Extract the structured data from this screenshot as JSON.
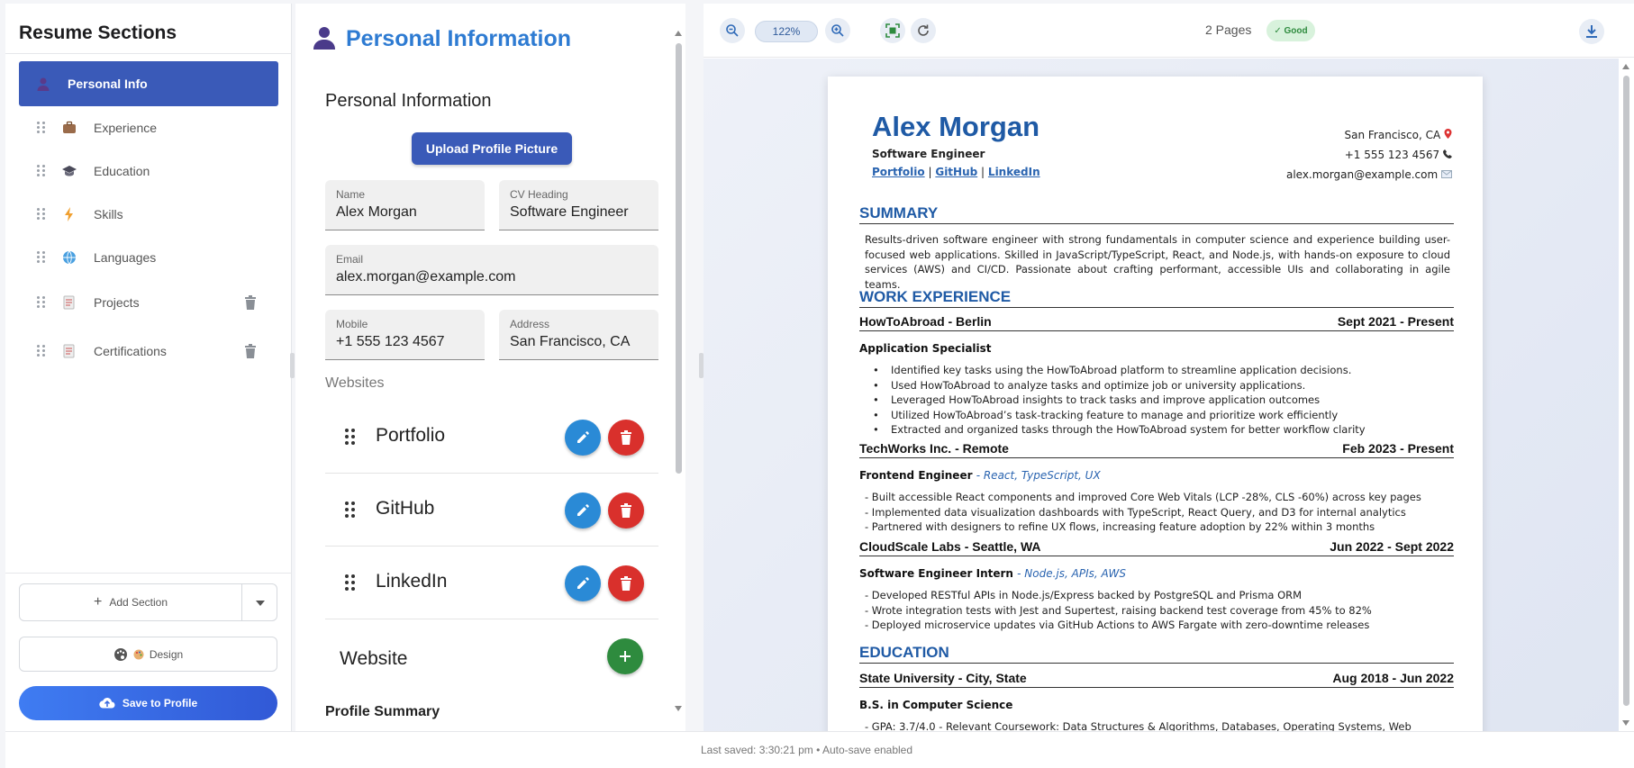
{
  "sidebar": {
    "title": "Resume Sections",
    "items": [
      {
        "label": "Personal Info",
        "icon": "person-icon",
        "active": true
      },
      {
        "label": "Experience",
        "icon": "briefcase-icon"
      },
      {
        "label": "Education",
        "icon": "graduation-cap-icon"
      },
      {
        "label": "Skills",
        "icon": "lightning-icon"
      },
      {
        "label": "Languages",
        "icon": "globe-icon"
      },
      {
        "label": "Projects",
        "icon": "document-icon",
        "deletable": true
      },
      {
        "label": "Certifications",
        "icon": "document-icon",
        "deletable": true
      }
    ],
    "add_section_label": "Add Section",
    "design_label": "Design",
    "save_label": "Save to Profile"
  },
  "editor": {
    "title": "Personal Information",
    "subtitle": "Personal Information",
    "upload_label": "Upload Profile Picture",
    "fields": {
      "name": {
        "label": "Name",
        "value": "Alex Morgan"
      },
      "cv_heading": {
        "label": "CV Heading",
        "value": "Software Engineer"
      },
      "email": {
        "label": "Email",
        "value": "alex.morgan@example.com"
      },
      "mobile": {
        "label": "Mobile",
        "value": "+1 555 123 4567"
      },
      "address": {
        "label": "Address",
        "value": "San Francisco, CA"
      }
    },
    "websites_label": "Websites",
    "websites": [
      "Portfolio",
      "GitHub",
      "LinkedIn"
    ],
    "website_add_label": "Website",
    "profile_summary_label": "Profile Summary"
  },
  "preview": {
    "zoom": "122%",
    "pages": "2 Pages",
    "quality_badge": "✓ Good",
    "resume": {
      "name": "Alex Morgan",
      "heading": "Software Engineer",
      "links": [
        "Portfolio",
        "GitHub",
        "LinkedIn"
      ],
      "link_separator": "|",
      "location": "San Francisco, CA",
      "phone": "+1 555 123 4567",
      "email": "alex.morgan@example.com",
      "summary_title": "SUMMARY",
      "summary_text": "Results-driven software engineer with strong fundamentals in computer science and experience building user-focused web applications. Skilled in JavaScript/TypeScript, React, and Node.js, with hands-on exposure to cloud services (AWS) and CI/CD. Passionate about crafting performant, accessible UIs and collaborating in agile teams.",
      "experience_title": "WORK EXPERIENCE",
      "jobs": [
        {
          "company": "HowToAbroad - Berlin",
          "dates": "Sept 2021 - Present",
          "role": "Application Specialist",
          "tags": "",
          "bullets": [
            "Identified key tasks using the HowToAbroad platform to streamline application decisions.",
            "Used HowToAbroad to analyze tasks and optimize job or university applications.",
            "Leveraged HowToAbroad insights to track tasks and improve application outcomes",
            "Utilized HowToAbroad’s task-tracking feature to manage and prioritize work efficiently",
            "Extracted and organized tasks through the HowToAbroad system for better workflow clarity"
          ]
        },
        {
          "company": "TechWorks Inc. - Remote",
          "dates": "Feb 2023 - Present",
          "role": "Frontend Engineer",
          "tags": "- React, TypeScript, UX",
          "bullets": [
            "- Built accessible React components and improved Core Web Vitals (LCP -28%, CLS -60%) across key pages",
            "- Implemented data visualization dashboards with TypeScript, React Query, and D3 for internal analytics",
            "- Partnered with designers to refine UX flows, increasing feature adoption by 22% within 3 months"
          ]
        },
        {
          "company": "CloudScale Labs - Seattle, WA",
          "dates": "Jun 2022 - Sept 2022",
          "role": "Software Engineer Intern",
          "tags": "- Node.js, APIs, AWS",
          "bullets": [
            "- Developed RESTful APIs in Node.js/Express backed by PostgreSQL and Prisma ORM",
            "- Wrote integration tests with Jest and Supertest, raising backend test coverage from 45% to 82%",
            "- Deployed microservice updates via GitHub Actions to AWS Fargate with zero-downtime releases"
          ]
        }
      ],
      "education_title": "EDUCATION",
      "education": {
        "school": "State University - City, State",
        "dates": "Aug 2018 - Jun 2022",
        "degree": "B.S. in Computer Science",
        "details": "- GPA: 3.7/4.0 - Relevant Coursework: Data Structures & Algorithms, Databases, Operating Systems, Web"
      }
    }
  },
  "status": "Last saved: 3:30:21 pm • Auto-save enabled",
  "colors": {
    "primary": "#3a5ab8",
    "title_blue": "#2e7bd2",
    "edit_blue": "#2a8ad6",
    "delete_red": "#d9302c",
    "add_green": "#2e8b3e",
    "resume_blue": "#1f5aa5"
  }
}
